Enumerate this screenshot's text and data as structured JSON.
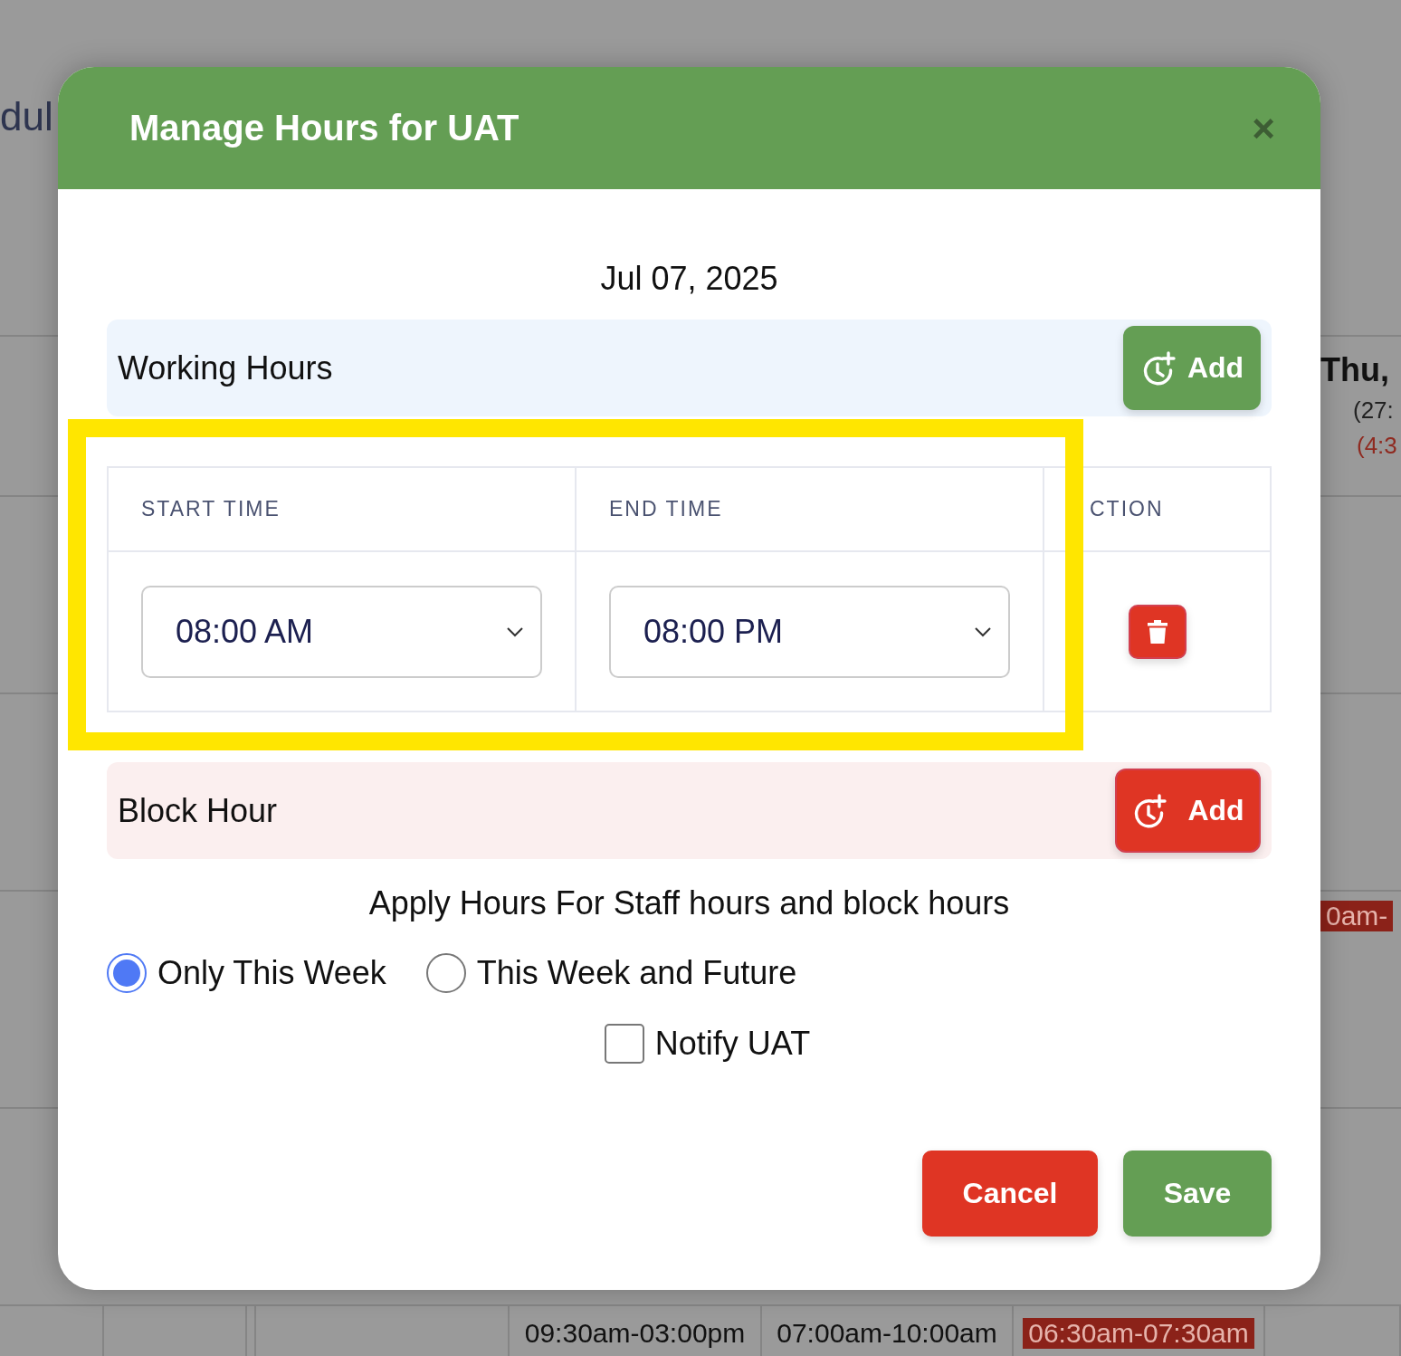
{
  "background": {
    "page_title": "dul",
    "day_header": "Thu,",
    "total_hours": "(27:",
    "block_hours": "(4:3",
    "shift_cut": {
      "text": "0am-",
      "blocked": true
    },
    "bottom_shifts": [
      {
        "text": "09:30am-03:00pm",
        "blocked": false
      },
      {
        "text": "07:00am-10:00am",
        "blocked": false
      },
      {
        "text": "06:30am-07:30am",
        "blocked": true
      }
    ]
  },
  "dialog": {
    "title": "Manage Hours for UAT",
    "close": "×",
    "date": "Jul 07, 2025",
    "working_hours": {
      "label": "Working Hours",
      "add_button": "Add"
    },
    "table": {
      "columns": [
        "START TIME",
        "END TIME",
        "CTION"
      ],
      "rows": [
        {
          "start": "08:00 AM",
          "end": "08:00 PM"
        }
      ]
    },
    "block_hour": {
      "label": "Block Hour",
      "add_button": "Add"
    },
    "apply_title": "Apply Hours For Staff hours and block hours",
    "scope_options": [
      {
        "label": "Only This Week",
        "selected": true
      },
      {
        "label": "This Week and Future",
        "selected": false
      }
    ],
    "notify": {
      "label": "Notify UAT",
      "checked": false
    },
    "buttons": [
      {
        "label": "Cancel",
        "kind": "cancel"
      },
      {
        "label": "Save",
        "kind": "save"
      }
    ]
  }
}
